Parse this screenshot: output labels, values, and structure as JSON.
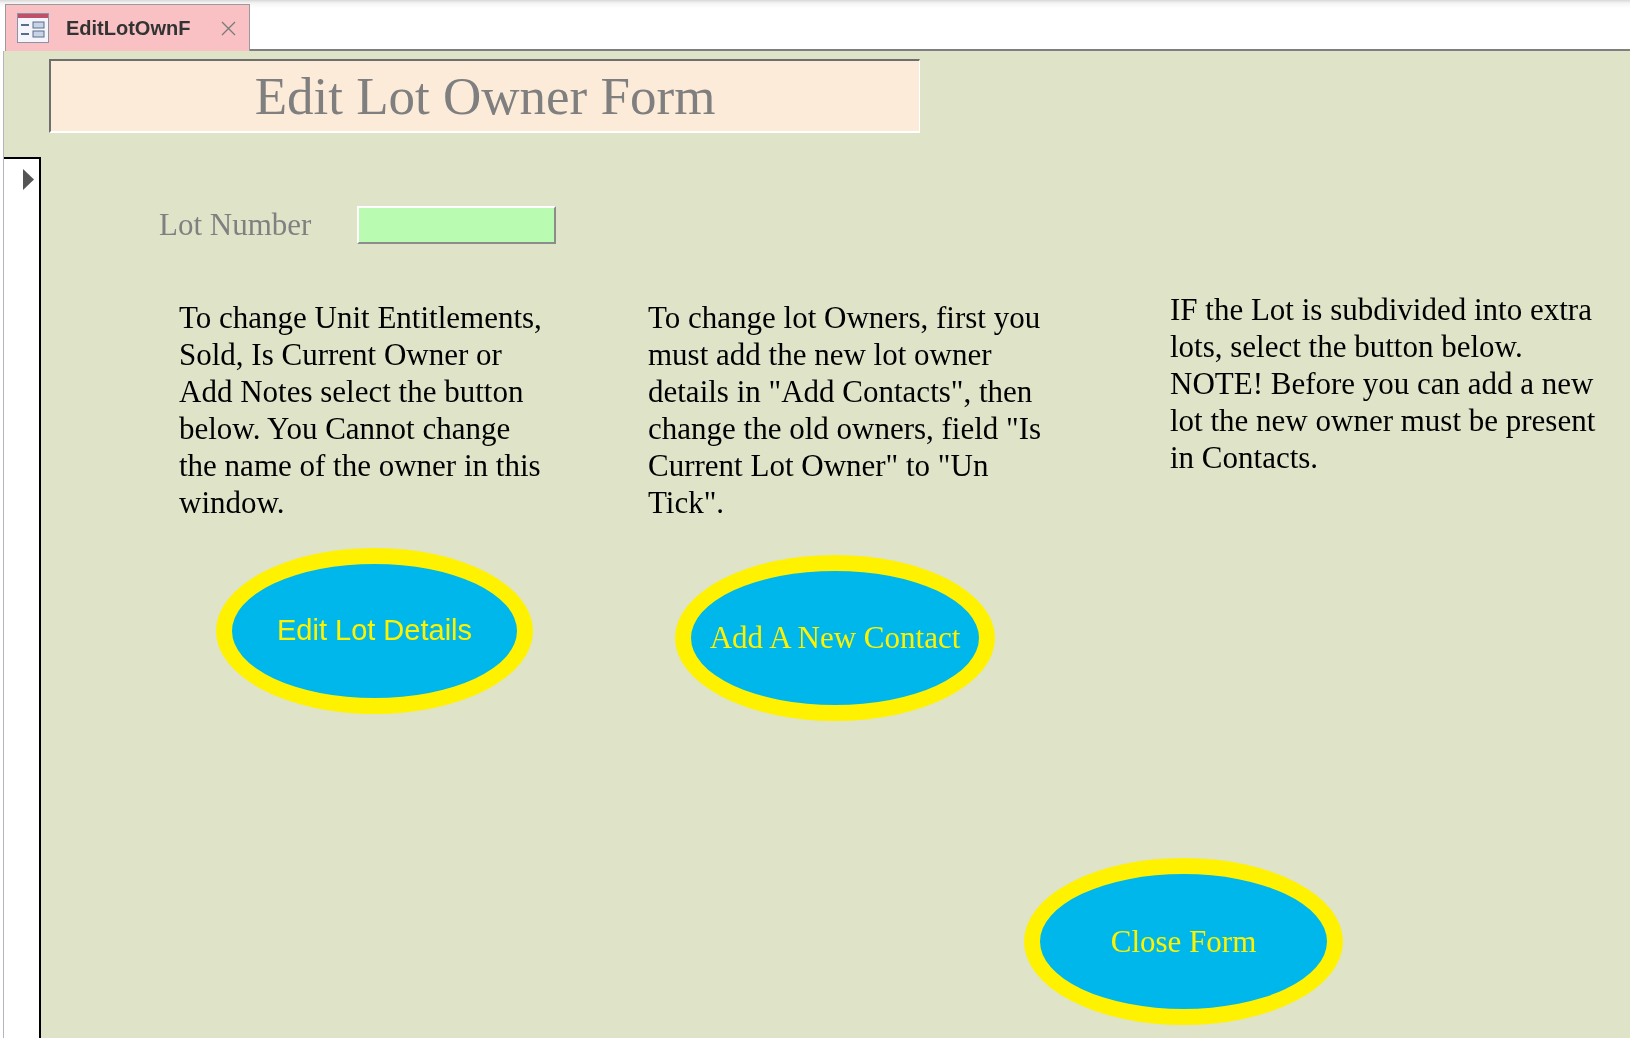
{
  "tab": {
    "label": "EditLotOwnF",
    "selected": true
  },
  "header": {
    "title": "Edit Lot Owner Form"
  },
  "lot_number": {
    "label": "Lot Number"
  },
  "columns": [
    {
      "text": "To change Unit Entitlements, Sold, Is Current Owner or Add Notes select the button below. You Cannot change the name of the owner in this window.",
      "button": "Edit Lot Details"
    },
    {
      "text": "To change lot Owners, first you must add the new lot owner details in \"Add Contacts\", then change the old owners, field \"Is Current Lot Owner\" to \"Un Tick\".",
      "button": "Add A New Contact"
    },
    {
      "text": "IF the Lot is subdivided into extra lots, select the button below. NOTE! Before you can add a new lot the new owner must be present in Contacts."
    }
  ],
  "close_button": "Close Form"
}
